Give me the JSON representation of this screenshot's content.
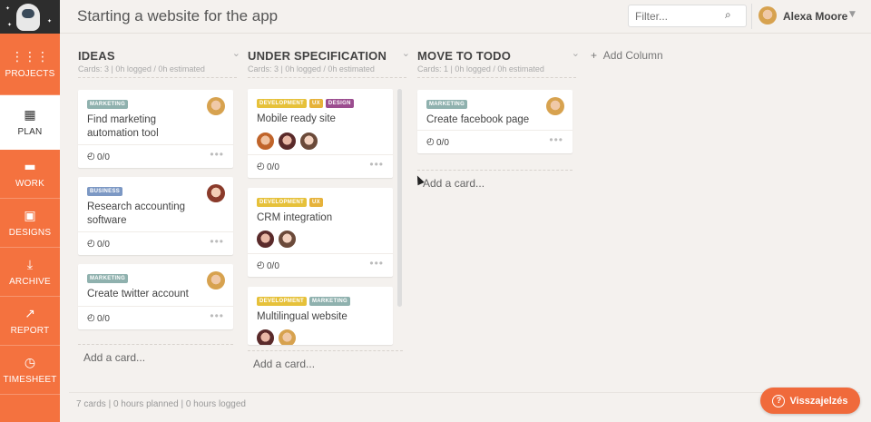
{
  "sidebar": {
    "items": [
      {
        "label": "PROJECTS",
        "icon": "grid-icon"
      },
      {
        "label": "PLAN",
        "icon": "calendar-icon"
      },
      {
        "label": "WORK",
        "icon": "briefcase-icon"
      },
      {
        "label": "DESIGNS",
        "icon": "image-icon"
      },
      {
        "label": "ARCHIVE",
        "icon": "download-icon"
      },
      {
        "label": "REPORT",
        "icon": "trend-icon"
      },
      {
        "label": "TIMESHEET",
        "icon": "clock-icon"
      }
    ]
  },
  "header": {
    "title": "Starting a website for the app",
    "filter_placeholder": "Filter...",
    "user_name": "Alexa Moore"
  },
  "columns": [
    {
      "title": "IDEAS",
      "subtitle": "Cards: 3 | 0h logged / 0h estimated",
      "add_card": "Add a card...",
      "cards": [
        {
          "tags": [
            {
              "label": "MARKETING",
              "color": "#8fb1ae"
            }
          ],
          "title": "Find marketing automation tool",
          "time": "0/0"
        },
        {
          "tags": [
            {
              "label": "BUSINESS",
              "color": "#7c98c4"
            }
          ],
          "title": "Research accounting software",
          "time": "0/0"
        },
        {
          "tags": [
            {
              "label": "MARKETING",
              "color": "#8fb1ae"
            }
          ],
          "title": "Create twitter account",
          "time": "0/0"
        }
      ]
    },
    {
      "title": "UNDER SPECIFICATION",
      "subtitle": "Cards: 3 | 0h logged / 0h estimated",
      "add_card": "Add a card...",
      "cards": [
        {
          "tags": [
            {
              "label": "DEVELOPMENT",
              "color": "#e6c13a"
            },
            {
              "label": "UX",
              "color": "#e6b23a"
            },
            {
              "label": "DESIGN",
              "color": "#9b4d8f"
            }
          ],
          "title": "Mobile ready site",
          "time": "0/0"
        },
        {
          "tags": [
            {
              "label": "DEVELOPMENT",
              "color": "#e6c13a"
            },
            {
              "label": "UX",
              "color": "#e6b23a"
            }
          ],
          "title": "CRM integration",
          "time": "0/0"
        },
        {
          "tags": [
            {
              "label": "DEVELOPMENT",
              "color": "#e6c13a"
            },
            {
              "label": "MARKETING",
              "color": "#8fb1ae"
            }
          ],
          "title": "Multilingual website"
        }
      ]
    },
    {
      "title": "MOVE TO TODO",
      "subtitle": "Cards: 1 | 0h logged / 0h estimated",
      "add_card": "Add a card...",
      "cards": [
        {
          "tags": [
            {
              "label": "MARKETING",
              "color": "#8fb1ae"
            }
          ],
          "title": "Create facebook page",
          "time": "0/0"
        }
      ]
    }
  ],
  "add_column": "Add Column",
  "footer": "7 cards | 0 hours planned | 0 hours logged",
  "feedback_label": "Visszajelzés"
}
